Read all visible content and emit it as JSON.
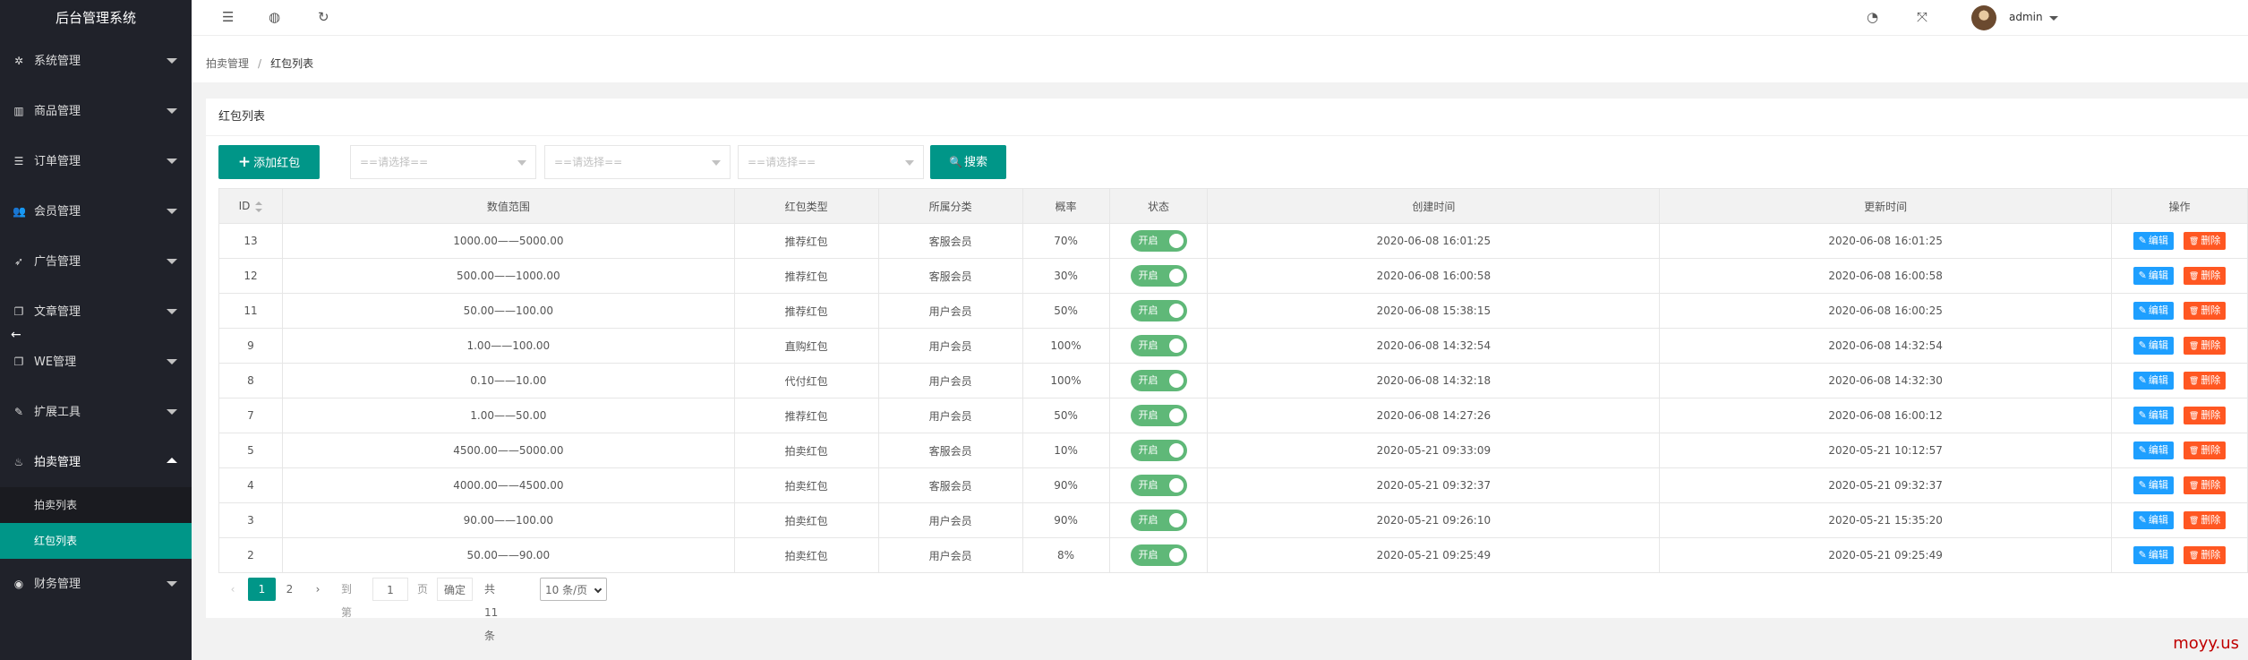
{
  "app": {
    "title": "后台管理系统"
  },
  "sidebar": {
    "items": [
      {
        "label": "系统管理",
        "icon": "gear-icon",
        "glyph": "✲"
      },
      {
        "label": "商品管理",
        "icon": "chart-icon",
        "glyph": "▥"
      },
      {
        "label": "订单管理",
        "icon": "list-icon",
        "glyph": "☰"
      },
      {
        "label": "会员管理",
        "icon": "users-icon",
        "glyph": "👥"
      },
      {
        "label": "广告管理",
        "icon": "rocket-icon",
        "glyph": "➶"
      },
      {
        "label": "文章管理",
        "icon": "copy-icon",
        "glyph": "❐"
      },
      {
        "label": "WE管理",
        "icon": "copy-icon",
        "glyph": "❐"
      },
      {
        "label": "扩展工具",
        "icon": "wrench-icon",
        "glyph": "✎"
      },
      {
        "label": "拍卖管理",
        "icon": "fire-icon",
        "glyph": "♨",
        "open": true
      },
      {
        "label": "财务管理",
        "icon": "circle-icon",
        "glyph": "◉"
      }
    ],
    "sub_items": [
      {
        "label": "拍卖列表"
      },
      {
        "label": "红包列表",
        "active": true
      }
    ],
    "collapse_glyph": "←"
  },
  "header": {
    "icons": [
      {
        "name": "menu-toggle-icon",
        "glyph": "☰"
      },
      {
        "name": "globe-icon",
        "glyph": "◍"
      },
      {
        "name": "refresh-icon",
        "glyph": "↻"
      },
      {
        "name": "theme-icon",
        "glyph": "◔"
      },
      {
        "name": "fullscreen-icon",
        "glyph": "⤧"
      }
    ],
    "user": "admin"
  },
  "breadcrumb": {
    "parent": "拍卖管理",
    "separator": "/",
    "current": "红包列表"
  },
  "card": {
    "title": "红包列表"
  },
  "toolbar": {
    "add_label": "添加红包",
    "add_glyph": "+",
    "select_placeholder": "==请选择==",
    "search_label": "搜索",
    "search_glyph": "🔍"
  },
  "table": {
    "columns": [
      "ID",
      "数值范围",
      "红包类型",
      "所属分类",
      "概率",
      "状态",
      "创建时间",
      "更新时间",
      "操作"
    ],
    "rows": [
      {
        "id": "13",
        "range": "1000.00——5000.00",
        "type": "推荐红包",
        "category": "客服会员",
        "rate": "70%",
        "status": "开启",
        "created": "2020-06-08 16:01:25",
        "updated": "2020-06-08 16:01:25"
      },
      {
        "id": "12",
        "range": "500.00——1000.00",
        "type": "推荐红包",
        "category": "客服会员",
        "rate": "30%",
        "status": "开启",
        "created": "2020-06-08 16:00:58",
        "updated": "2020-06-08 16:00:58"
      },
      {
        "id": "11",
        "range": "50.00——100.00",
        "type": "推荐红包",
        "category": "用户会员",
        "rate": "50%",
        "status": "开启",
        "created": "2020-06-08 15:38:15",
        "updated": "2020-06-08 16:00:25"
      },
      {
        "id": "9",
        "range": "1.00——100.00",
        "type": "直购红包",
        "category": "用户会员",
        "rate": "100%",
        "status": "开启",
        "created": "2020-06-08 14:32:54",
        "updated": "2020-06-08 14:32:54"
      },
      {
        "id": "8",
        "range": "0.10——10.00",
        "type": "代付红包",
        "category": "用户会员",
        "rate": "100%",
        "status": "开启",
        "created": "2020-06-08 14:32:18",
        "updated": "2020-06-08 14:32:30"
      },
      {
        "id": "7",
        "range": "1.00——50.00",
        "type": "推荐红包",
        "category": "用户会员",
        "rate": "50%",
        "status": "开启",
        "created": "2020-06-08 14:27:26",
        "updated": "2020-06-08 16:00:12"
      },
      {
        "id": "5",
        "range": "4500.00——5000.00",
        "type": "拍卖红包",
        "category": "客服会员",
        "rate": "10%",
        "status": "开启",
        "created": "2020-05-21 09:33:09",
        "updated": "2020-05-21 10:12:57"
      },
      {
        "id": "4",
        "range": "4000.00——4500.00",
        "type": "拍卖红包",
        "category": "客服会员",
        "rate": "90%",
        "status": "开启",
        "created": "2020-05-21 09:32:37",
        "updated": "2020-05-21 09:32:37"
      },
      {
        "id": "3",
        "range": "90.00——100.00",
        "type": "拍卖红包",
        "category": "用户会员",
        "rate": "90%",
        "status": "开启",
        "created": "2020-05-21 09:26:10",
        "updated": "2020-05-21 15:35:20"
      },
      {
        "id": "2",
        "range": "50.00——90.00",
        "type": "拍卖红包",
        "category": "用户会员",
        "rate": "8%",
        "status": "开启",
        "created": "2020-05-21 09:25:49",
        "updated": "2020-05-21 09:25:49"
      }
    ],
    "edit_label": "编辑",
    "edit_glyph": "✎",
    "delete_label": "删除",
    "delete_glyph": "🗑"
  },
  "pager": {
    "prev_glyph": "‹",
    "next_glyph": "›",
    "pages": [
      "1",
      "2"
    ],
    "current_page": "1",
    "goto_label": "到第",
    "goto_value": "1",
    "page_suffix": "页",
    "confirm_label": "确定",
    "total_label": "共 11 条",
    "page_size": "10 条/页"
  },
  "watermark": "moyy.us",
  "colors": {
    "primary": "#009688",
    "sidebar_bg": "#20222a",
    "switch_on": "#5fb878",
    "edit": "#1e9fff",
    "delete": "#ff5722"
  }
}
